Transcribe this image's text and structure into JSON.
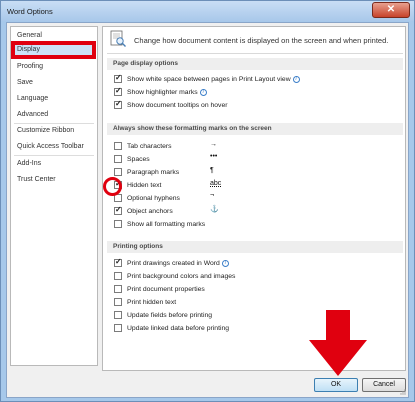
{
  "window": {
    "title": "Word Options",
    "close_glyph": "✕"
  },
  "sidebar": {
    "items": [
      {
        "label": "General"
      },
      {
        "label": "Display"
      },
      {
        "label": "Proofing"
      },
      {
        "label": "Save"
      },
      {
        "label": "Language"
      },
      {
        "label": "Advanced"
      },
      {
        "label": "Customize Ribbon"
      },
      {
        "label": "Quick Access Toolbar"
      },
      {
        "label": "Add-Ins"
      },
      {
        "label": "Trust Center"
      }
    ],
    "selected": "Display"
  },
  "header": {
    "text": "Change how document content is displayed on the screen and when printed."
  },
  "sections": {
    "page_display": {
      "title": "Page display options",
      "options": [
        {
          "label": "Show white space between pages in Print Layout view",
          "checked": true,
          "info": true
        },
        {
          "label": "Show highlighter marks",
          "checked": true,
          "info": true
        },
        {
          "label": "Show document tooltips on hover",
          "checked": true,
          "info": false
        }
      ]
    },
    "formatting_marks": {
      "title": "Always show these formatting marks on the screen",
      "options": [
        {
          "label": "Tab characters",
          "checked": false,
          "symbol": "→"
        },
        {
          "label": "Spaces",
          "checked": false,
          "symbol": "•••"
        },
        {
          "label": "Paragraph marks",
          "checked": false,
          "symbol": "¶"
        },
        {
          "label": "Hidden text",
          "checked": true,
          "symbol": "abc"
        },
        {
          "label": "Optional hyphens",
          "checked": false,
          "symbol": "¬"
        },
        {
          "label": "Object anchors",
          "checked": true,
          "symbol": "⚓"
        },
        {
          "label": "Show all formatting marks",
          "checked": false,
          "symbol": ""
        }
      ]
    },
    "printing": {
      "title": "Printing options",
      "options": [
        {
          "label": "Print drawings created in Word",
          "checked": true,
          "info": true
        },
        {
          "label": "Print background colors and images",
          "checked": false,
          "info": false
        },
        {
          "label": "Print document properties",
          "checked": false,
          "info": false
        },
        {
          "label": "Print hidden text",
          "checked": false,
          "info": false
        },
        {
          "label": "Update fields before printing",
          "checked": false,
          "info": false
        },
        {
          "label": "Update linked data before printing",
          "checked": false,
          "info": false
        }
      ]
    }
  },
  "footer": {
    "ok_label": "OK",
    "cancel_label": "Cancel"
  },
  "colors": {
    "annotation_red": "#e0000f",
    "selected_bg": "#cde3f7"
  }
}
